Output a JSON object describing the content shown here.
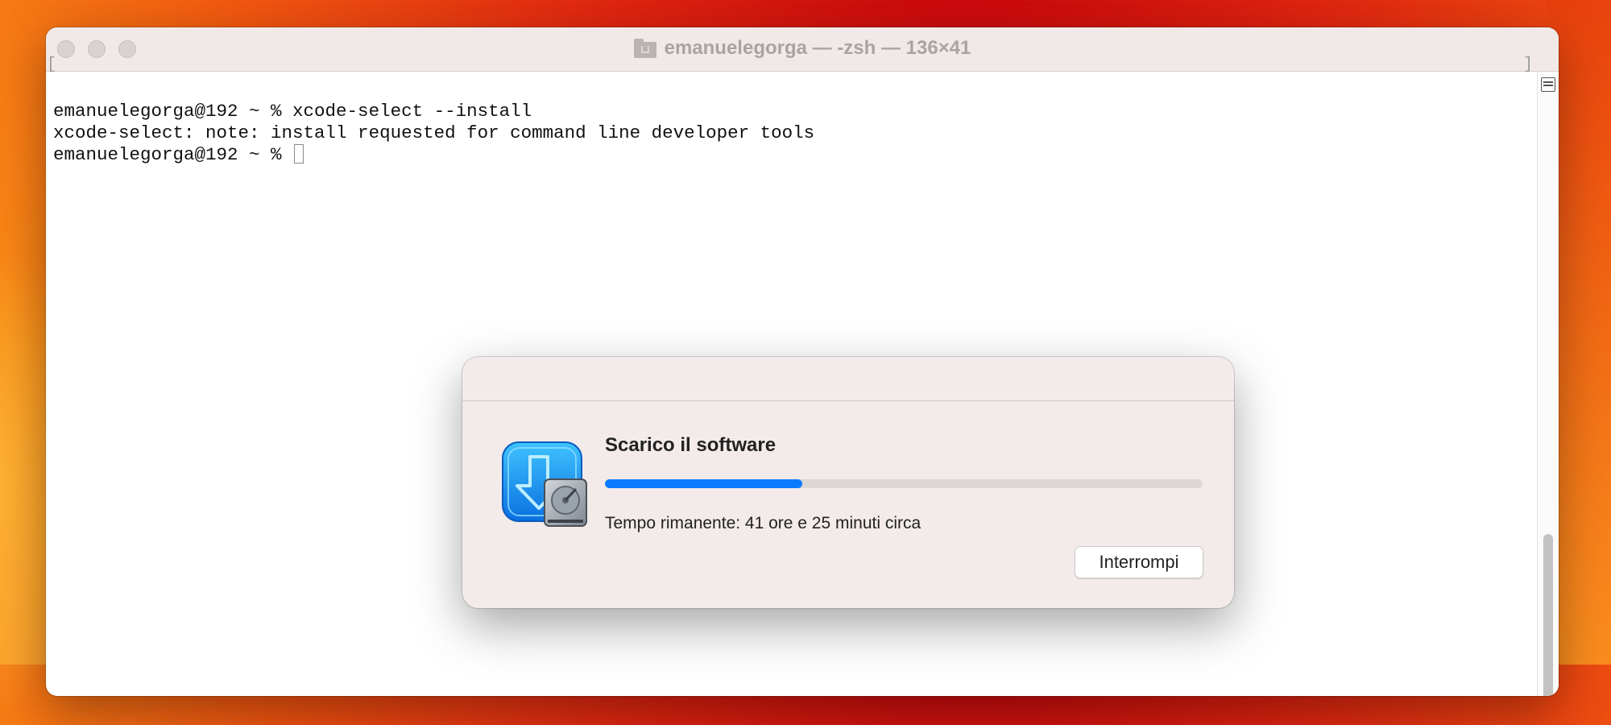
{
  "window": {
    "title": "emanuelegorga — -zsh — 136×41"
  },
  "terminal": {
    "lines": [
      "emanuelegorga@192 ~ % xcode-select --install",
      "xcode-select: note: install requested for command line developer tools",
      "emanuelegorga@192 ~ % "
    ]
  },
  "dialog": {
    "heading": "Scarico il software",
    "progress_fraction": 0.33,
    "status": "Tempo rimanente: 41 ore e 25 minuti circa",
    "cancel_label": "Interrompi"
  },
  "colors": {
    "accent": "#0a7bff",
    "dialog_bg": "#f3ebea"
  },
  "icons": {
    "dialog": "software-installer-icon",
    "title": "home-folder-icon"
  }
}
